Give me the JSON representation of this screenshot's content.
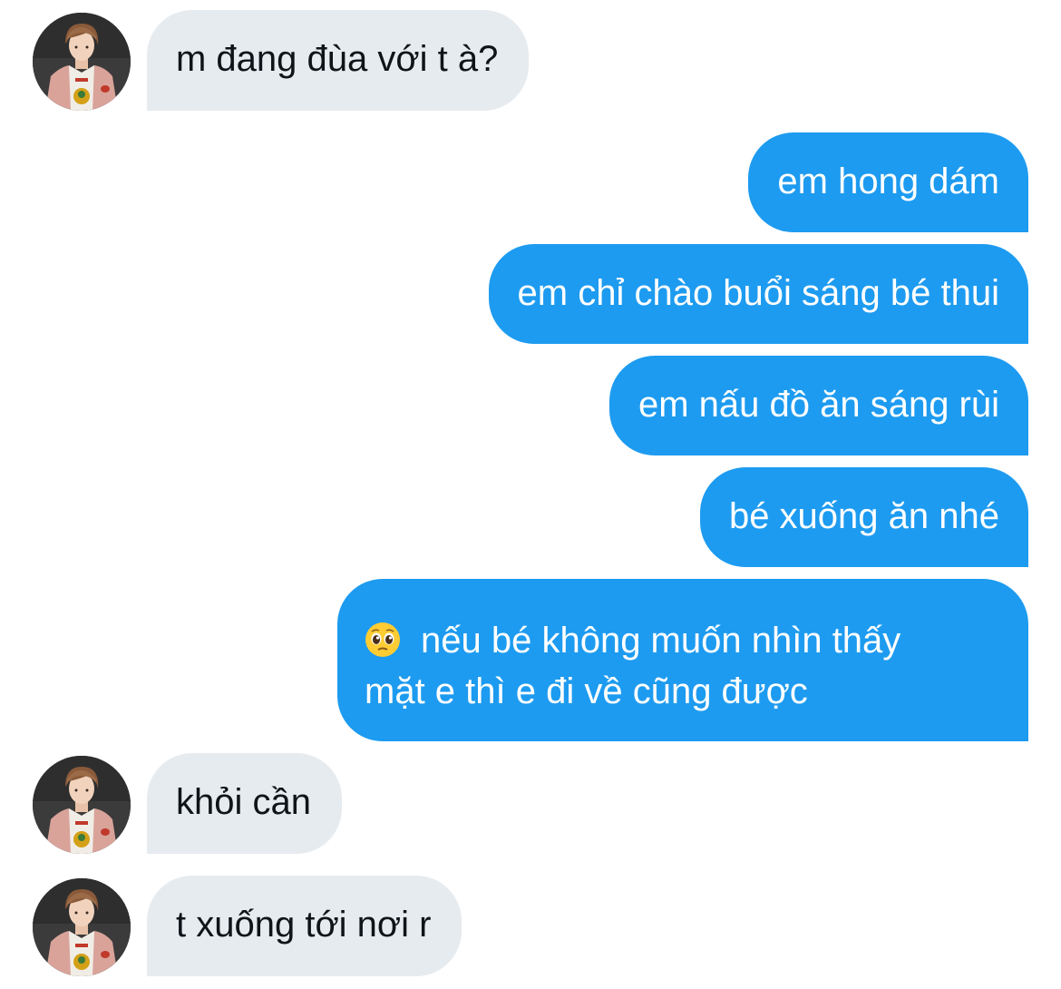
{
  "messages": [
    {
      "side": "received",
      "text": "m đang đùa với t à?"
    },
    {
      "side": "sent",
      "text": "em hong dám"
    },
    {
      "side": "sent",
      "text": "em chỉ chào buổi sáng bé thui"
    },
    {
      "side": "sent",
      "text": "em nấu đồ ăn sáng rùi"
    },
    {
      "side": "sent",
      "text": "bé xuống ăn nhé"
    },
    {
      "side": "sent",
      "emoji": "pleading-face",
      "line1": "nếu bé không muốn nhìn thấy",
      "line2": "mặt e thì e đi về cũng được"
    },
    {
      "side": "received",
      "text": "khỏi cần"
    },
    {
      "side": "received",
      "text": "t xuống tới nơi r"
    }
  ],
  "colors": {
    "sent_bubble": "#1d9bf0",
    "received_bubble": "#e6ebef",
    "received_text": "#0f1419",
    "sent_text": "#ffffff"
  }
}
